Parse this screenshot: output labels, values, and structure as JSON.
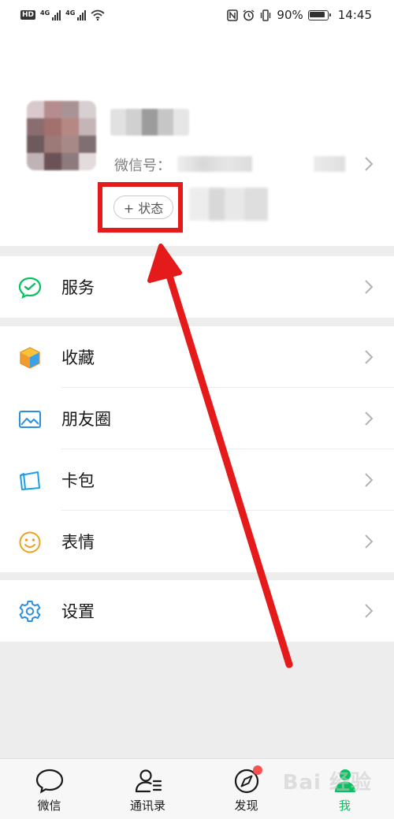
{
  "status_bar": {
    "hd_badge": "HD",
    "network_1": "4G",
    "network_2": "4G",
    "battery": "90%",
    "time": "14:45"
  },
  "profile": {
    "wechat_id_label": "微信号：",
    "status_button": "+ 状态"
  },
  "menu": {
    "services": "服务",
    "favorites": "收藏",
    "moments": "朋友圈",
    "cards": "卡包",
    "stickers": "表情",
    "settings": "设置"
  },
  "tabs": [
    {
      "label": "微信"
    },
    {
      "label": "通讯录"
    },
    {
      "label": "发现"
    },
    {
      "label": "我"
    }
  ],
  "watermark": "Bai 经验",
  "colors": {
    "accent": "#07c160",
    "highlight": "#e51a1a",
    "badge": "#fa5151",
    "services_icon": "#07c160",
    "favorites_icon": "#f5a623",
    "moments_icon": "#2b8fe0",
    "cards_icon": "#1aa0e8",
    "stickers_icon": "#f0a020",
    "settings_icon": "#2b8fe0"
  }
}
